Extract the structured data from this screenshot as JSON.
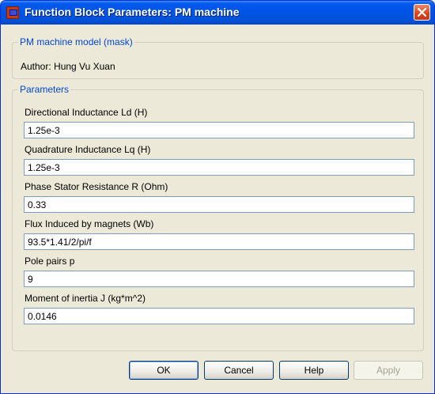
{
  "window": {
    "title": "Function Block Parameters: PM machine"
  },
  "mask_group": {
    "legend": "PM machine model (mask)",
    "author": "Author: Hung Vu Xuan"
  },
  "parameters": {
    "legend": "Parameters",
    "fields": [
      {
        "label": "Directional Inductance Ld (H)",
        "value": "1.25e-3"
      },
      {
        "label": "Quadrature Inductance Lq (H)",
        "value": "1.25e-3"
      },
      {
        "label": "Phase Stator Resistance R (Ohm)",
        "value": "0.33"
      },
      {
        "label": "Flux Induced by magnets (Wb)",
        "value": "93.5*1.41/2/pi/f"
      },
      {
        "label": "Pole pairs p",
        "value": "9"
      },
      {
        "label": "Moment of inertia J (kg*m^2)",
        "value": "0.0146"
      }
    ]
  },
  "buttons": {
    "ok": "OK",
    "cancel": "Cancel",
    "help": "Help",
    "apply": "Apply"
  },
  "colors": {
    "titlebar": "#0054e3",
    "dialog_bg": "#ece9d8",
    "legend_text": "#0046d5",
    "close_button": "#d8431b"
  },
  "icons": {
    "app": "simulink-block-icon",
    "close": "close-icon"
  }
}
